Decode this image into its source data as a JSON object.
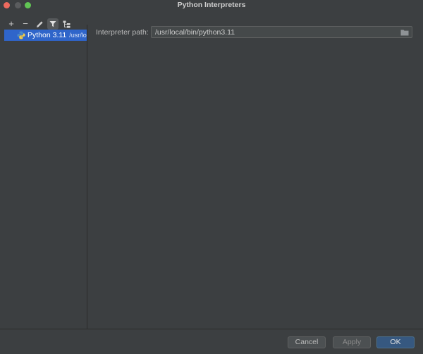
{
  "window": {
    "title": "Python Interpreters"
  },
  "toolbar": {
    "add_icon": "+",
    "remove_icon": "−",
    "edit_icon": "pencil-icon",
    "filter_icon": "filter-icon",
    "tree_icon": "tree-icon"
  },
  "interpreters": [
    {
      "name": "Python 3.11",
      "path": "/usr/local/bin/python3.11",
      "selected": true
    }
  ],
  "details": {
    "path_label": "Interpreter path:",
    "path_value": "/usr/local/bin/python3.11"
  },
  "footer": {
    "cancel_label": "Cancel",
    "apply_label": "Apply",
    "ok_label": "OK"
  },
  "colors": {
    "background": "#3c3f41",
    "selection": "#2f65ca",
    "primary_button": "#365880"
  }
}
